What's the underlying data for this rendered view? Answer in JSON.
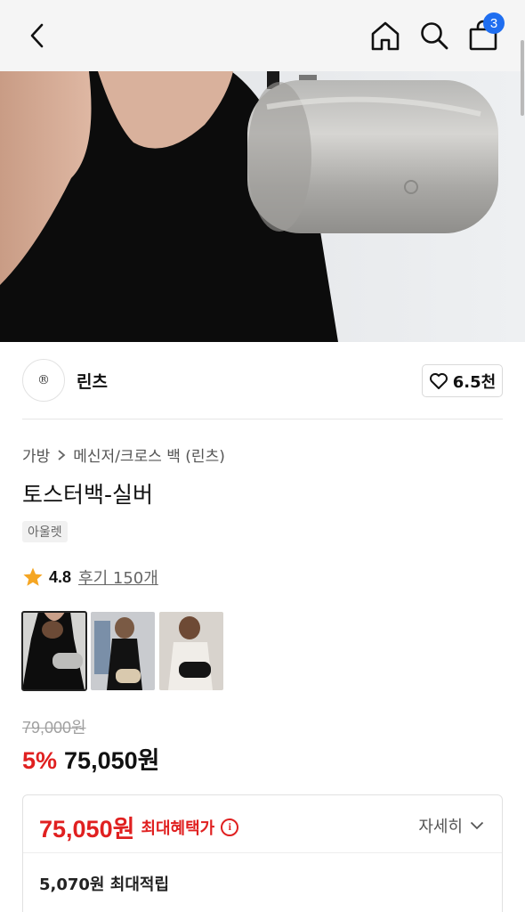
{
  "header": {
    "cart_count": "3"
  },
  "brand": {
    "logo_text": "®",
    "name": "린츠",
    "likes": "6.5천"
  },
  "breadcrumb": [
    "가방",
    "메신저/크로스 백 (린츠)"
  ],
  "product": {
    "title": "토스터백-실버",
    "badge": "아울렛",
    "rating": "4.8",
    "review_label": "후기 150개",
    "original_price": "79,000원",
    "discount": "5%",
    "sale_price": "75,050원"
  },
  "benefit": {
    "max_price": "75,050원",
    "max_label": "최대혜택가",
    "detail_label": "자세히",
    "points": "5,070원 최대적립"
  },
  "colors": {
    "accent_red": "#e02020",
    "badge_blue": "#1f6ef0",
    "star": "#f5a623"
  },
  "icons": [
    "back-icon",
    "home-icon",
    "search-icon",
    "shopping-bag-icon",
    "heart-icon",
    "star-icon",
    "info-icon",
    "chevron-down-icon",
    "chevron-right-icon"
  ]
}
